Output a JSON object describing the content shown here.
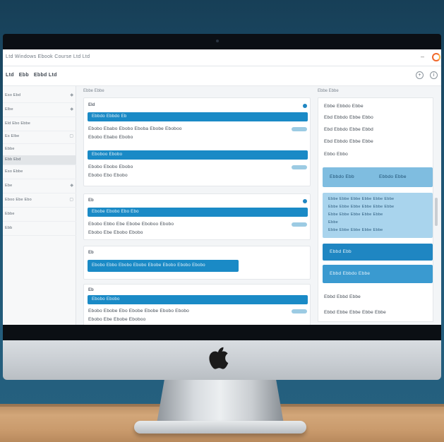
{
  "window": {
    "title": "Ltd Windows Ebook Course Ltd Ltd",
    "minimize": "–"
  },
  "toolbar": {
    "menu": [
      "Ltd",
      "Ebb",
      "Ebbd Ltd"
    ],
    "icon_1": "+",
    "icon_2": "i"
  },
  "sidebar": {
    "items": [
      {
        "label": "Eso Ebd"
      },
      {
        "label": "Elbe"
      },
      {
        "label": "Eld Ebo Ebbe"
      },
      {
        "label": "Es Elbe"
      },
      {
        "label": "Ebbe"
      },
      {
        "label": "Ebb Ebd"
      },
      {
        "label": "Eso Ebbe"
      },
      {
        "label": "Ebe"
      },
      {
        "label": "Eboo Ebe Ebo"
      },
      {
        "label": "Ebbe"
      },
      {
        "label": "Ebb"
      }
    ]
  },
  "main": {
    "header": "Ebbe Ebbe",
    "cards": [
      {
        "num": "Eld",
        "bar1": "Ebbdo Ebbdo Eb",
        "row1": "Ebobo Ebabo Ebobo Eboba Ebobe Eboboo",
        "row2": "Ebobo Ebabo Ebobo",
        "bar2": "Eboboo Ebobo",
        "row3": "Ebobo Ebobo Ebobo",
        "row4": "Ebobo Ebo Ebobo"
      },
      {
        "num": "Eb",
        "bar1": "Ebobe Ebobo Ebo Ebo",
        "row1": "Ebobo Ebbo Ebe Ebobe Eboboo Ebobo",
        "row2": "Ebobo Ebe Ebobo Ebobo"
      },
      {
        "num": "Eb",
        "bar1": "Ebobo  Ebbo Ebobo Ebobo Ebobe Ebobo Ebobo Ebobo"
      },
      {
        "num": "Eb",
        "bar1": "Ebobo Ebobo",
        "row1": "Ebobo Ebobe Ebo Ebobe Ebobe Ebobo Ebobo",
        "row2": "Ebobo Ebe Ebobe Eboboo"
      }
    ]
  },
  "right": {
    "header": "Ebbe Ebbe",
    "rows": [
      "Ebbe Ebbdo Ebbe",
      "Ebd   Ebbdo Ebbe Ebbo",
      "Ebd   Ebbdo Ebbe Ebbd",
      "Ebd   Ebbdo Ebbe Ebbe",
      "Ebbo Ebbo"
    ],
    "box1_left": "Ebbdo Ebb",
    "box1_right": "Ebbdo Ebbe",
    "list": [
      "Ebbe Ebbe Ebbe Ebbe Ebbe Ebbe",
      "Ebbe Ebbe Ebbe Ebbe Ebbe Ebbe",
      "Ebbe Ebbe Ebbe Ebbe Ebbe",
      "Ebbe",
      "Ebbe Ebbe Ebbe Ebbe Ebbe"
    ],
    "box2": "Ebbd Ebb",
    "box3": "Ebbd Ebbdo Ebbe",
    "foot_row1": "Ebbd Ebbd Ebbe",
    "foot_row2": "Ebbd Ebbe Ebbe Ebbe Ebbe"
  },
  "colors": {
    "accent": "#1a8ac6",
    "light_accent": "#8fc6e6",
    "wall": "#1f5675",
    "desk": "#d2a679"
  }
}
